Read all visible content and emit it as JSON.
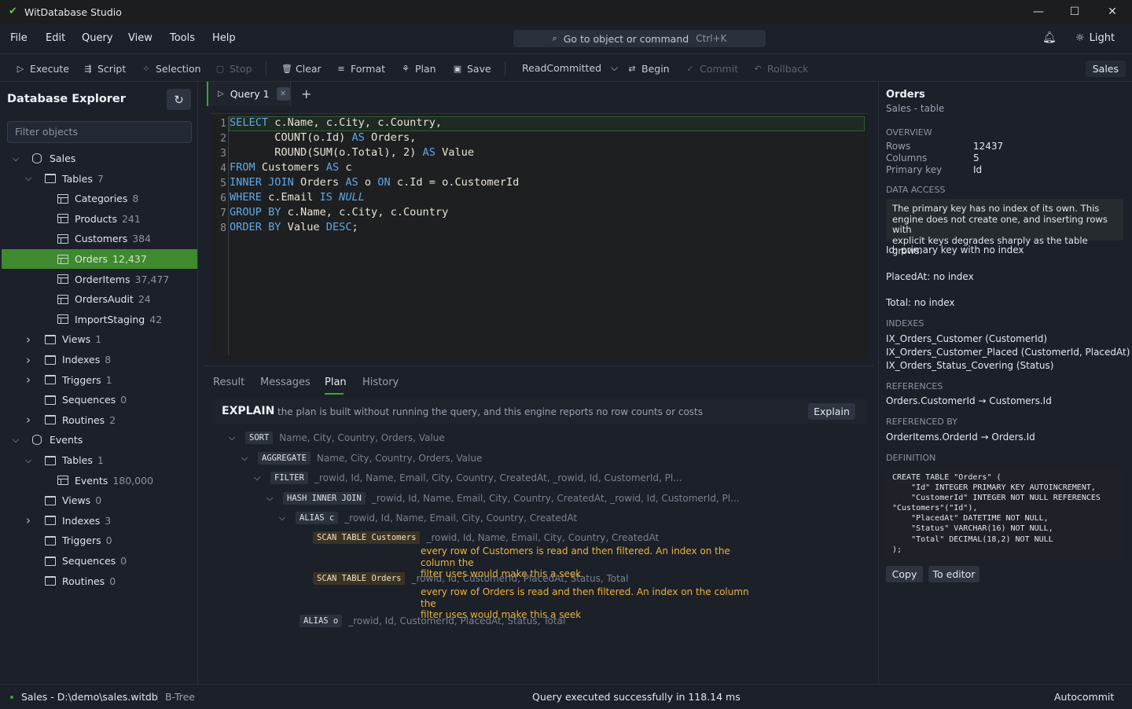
{
  "app": {
    "title": "WitDatabase Studio"
  },
  "menu": [
    "File",
    "Edit",
    "Query",
    "View",
    "Tools",
    "Help"
  ],
  "command_palette": {
    "label": "Go to object or command",
    "shortcut": "Ctrl+K"
  },
  "theme_toggle": "Light",
  "toolbar": {
    "execute": "Execute",
    "script": "Script",
    "selection": "Selection",
    "stop": "Stop",
    "clear": "Clear",
    "format": "Format",
    "plan": "Plan",
    "save": "Save",
    "isolation": "ReadCommitted",
    "begin": "Begin",
    "commit": "Commit",
    "rollback": "Rollback",
    "database": "Sales"
  },
  "explorer": {
    "title": "Database Explorer",
    "filter_placeholder": "Filter objects",
    "nodes": [
      {
        "label": "Sales",
        "count": ""
      },
      {
        "label": "Tables",
        "count": "7"
      },
      {
        "label": "Categories",
        "count": "8"
      },
      {
        "label": "Products",
        "count": "241"
      },
      {
        "label": "Customers",
        "count": "384"
      },
      {
        "label": "Orders",
        "count": "12,437"
      },
      {
        "label": "OrderItems",
        "count": "37,477"
      },
      {
        "label": "OrdersAudit",
        "count": "24"
      },
      {
        "label": "ImportStaging",
        "count": "42"
      },
      {
        "label": "Views",
        "count": "1"
      },
      {
        "label": "Indexes",
        "count": "8"
      },
      {
        "label": "Triggers",
        "count": "1"
      },
      {
        "label": "Sequences",
        "count": "0"
      },
      {
        "label": "Routines",
        "count": "2"
      },
      {
        "label": "Events",
        "count": ""
      },
      {
        "label": "Tables",
        "count": "1"
      },
      {
        "label": "Events",
        "count": "180,000"
      },
      {
        "label": "Views",
        "count": "0"
      },
      {
        "label": "Indexes",
        "count": "3"
      },
      {
        "label": "Triggers",
        "count": "0"
      },
      {
        "label": "Sequences",
        "count": "0"
      },
      {
        "label": "Routines",
        "count": "0"
      }
    ]
  },
  "editor": {
    "tab": "Query 1",
    "line_numbers": [
      "1",
      "2",
      "3",
      "4",
      "5",
      "6",
      "7",
      "8"
    ]
  },
  "results": {
    "tabs": [
      "Result",
      "Messages",
      "Plan",
      "History"
    ],
    "explain_title": "EXPLAIN",
    "explain_desc": "the plan is built without running the query, and this engine reports no row counts or costs",
    "explain_button": "Explain",
    "plan": [
      {
        "op": "SORT",
        "cols": "Name, City, Country, Orders, Value"
      },
      {
        "op": "AGGREGATE",
        "cols": "Name, City, Country, Orders, Value"
      },
      {
        "op": "FILTER",
        "cols": "_rowid, Id, Name, Email, City, Country, CreatedAt, _rowid, Id, CustomerId, Pl..."
      },
      {
        "op": "HASH INNER JOIN",
        "cols": "_rowid, Id, Name, Email, City, Country, CreatedAt, _rowid, Id, CustomerId, Pl..."
      },
      {
        "op": "ALIAS c",
        "cols": "_rowid, Id, Name, Email, City, Country, CreatedAt"
      },
      {
        "op": "SCAN TABLE Customers",
        "cols": "_rowid, Id, Name, Email, City, Country, CreatedAt",
        "warn1": "every row of Customers is read and then filtered. An index on the column the",
        "warn2": "filter uses would make this a seek"
      },
      {
        "op": "SCAN TABLE Orders",
        "cols": "_rowid, Id, CustomerId, PlacedAt, Status, Total",
        "warn1": "every row of Orders is read and then filtered. An index on the column the",
        "warn2": "filter uses would make this a seek"
      },
      {
        "op": "ALIAS o",
        "cols": "_rowid, Id, CustomerId, PlacedAt, Status, Total"
      }
    ]
  },
  "props": {
    "title": "Orders",
    "subtitle": "Sales - table",
    "overview_h": "OVERVIEW",
    "rows_k": "Rows",
    "rows_v": "12437",
    "cols_k": "Columns",
    "cols_v": "5",
    "pk_k": "Primary key",
    "pk_v": "Id",
    "access_h": "DATA ACCESS",
    "notice1": "The primary key has no index of its own. This",
    "notice2": "engine does not create one, and inserting rows with",
    "notice3": "explicit keys degrades sharply as the table grows.",
    "access": [
      "Id: primary key with no index",
      "PlacedAt: no index",
      "Total: no index"
    ],
    "indexes_h": "INDEXES",
    "indexes": [
      "IX_Orders_Customer (CustomerId)",
      "IX_Orders_Customer_Placed (CustomerId, PlacedAt)",
      "IX_Orders_Status_Covering (Status)"
    ],
    "references_h": "REFERENCES",
    "references": "Orders.CustomerId → Customers.Id",
    "referenced_h": "REFERENCED BY",
    "referenced": "OrderItems.OrderId → Orders.Id",
    "definition_h": "DEFINITION",
    "ddl": "CREATE TABLE \"Orders\" (\n    \"Id\" INTEGER PRIMARY KEY AUTOINCREMENT,\n    \"CustomerId\" INTEGER NOT NULL REFERENCES\n\"Customers\"(\"Id\"),\n    \"PlacedAt\" DATETIME NOT NULL,\n    \"Status\" VARCHAR(16) NOT NULL,\n    \"Total\" DECIMAL(18,2) NOT NULL\n);",
    "copy": "Copy",
    "to_editor": "To editor"
  },
  "status": {
    "connection": "Sales - D:\\demo\\sales.witdb",
    "engine": "B-Tree",
    "message": "Query executed successfully in 118.14 ms",
    "mode": "Autocommit"
  }
}
